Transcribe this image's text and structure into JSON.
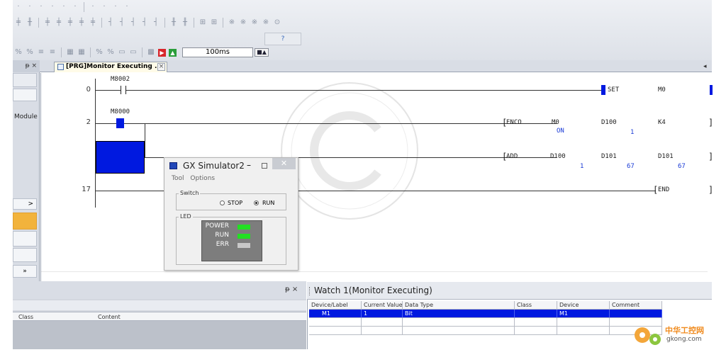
{
  "toolbar": {
    "monitor_interval": "100ms",
    "help_glyph": "?"
  },
  "left_pane": {
    "pin_glyph": "ᵽ ×",
    "module_label": "Module",
    "expand_glyph": ">",
    "more_glyph": "»"
  },
  "tab": {
    "label": "[PRG]Monitor Executing ...",
    "close_glyph": "×",
    "scroll_glyph": "◂"
  },
  "ladder": {
    "rungs": [
      {
        "step": "0",
        "contact": "M8002",
        "instruction": "SET",
        "operands": [
          "M0"
        ]
      },
      {
        "step": "2",
        "contact": "M8000",
        "instruction": "ENCO",
        "operands": [
          "M0",
          "D100",
          "K4"
        ],
        "values": [
          "ON",
          "1"
        ]
      },
      {
        "instruction": "ADD",
        "operands": [
          "D100",
          "D101",
          "D101"
        ],
        "values": [
          "1",
          "67",
          "67"
        ]
      },
      {
        "step": "17",
        "instruction": "END"
      }
    ]
  },
  "simulator": {
    "title": "GX Simulator2",
    "min_glyph": "–",
    "close_glyph": "✕",
    "menu": [
      "Tool",
      "Options"
    ],
    "switch_label": "Switch",
    "stop_label": "STOP",
    "run_label": "RUN",
    "selected": "RUN",
    "led_label": "LED",
    "leds": [
      {
        "name": "POWER",
        "color": "#22e022"
      },
      {
        "name": "RUN",
        "color": "#22e022"
      },
      {
        "name": "ERR",
        "color": "#c8c8c8"
      }
    ]
  },
  "output_pane": {
    "pin_glyph": "ᵽ ×",
    "columns": [
      "Class",
      "Content"
    ]
  },
  "watch": {
    "title": "Watch 1(Monitor Executing)",
    "columns": [
      "Device/Label",
      "Current Value",
      "Data Type",
      "Class",
      "Device",
      "Comment"
    ],
    "rows": [
      {
        "device_label": "M1",
        "current_value": "1",
        "data_type": "Bit",
        "class": "",
        "device": "M1",
        "comment": ""
      }
    ]
  },
  "watermark": {
    "brand": "中华工控网",
    "site": "gkong.com"
  },
  "colors": {
    "accent_blue": "#0019e0",
    "led_on": "#22e022"
  }
}
